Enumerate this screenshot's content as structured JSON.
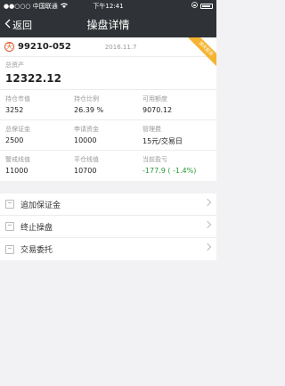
{
  "status_bar": {
    "carrier": "●●○○○ 中国联通",
    "wifi_icon": "wifi-icon",
    "time": "下午12:41",
    "lock_icon": "orientation-lock-icon",
    "battery_icon": "battery-icon"
  },
  "nav": {
    "back_label": "返回",
    "back_icon": "chevron-left-icon",
    "title": "操盘详情"
  },
  "account": {
    "icon_glyph": "天",
    "id": "99210-052",
    "date": "2016.11.7",
    "ribbon": "按天配资"
  },
  "total": {
    "label": "总资产",
    "value": "12322.12"
  },
  "rows": [
    [
      {
        "label": "持仓市值",
        "value": "3252"
      },
      {
        "label": "持仓比例",
        "value": "26.39 %"
      },
      {
        "label": "可用额度",
        "value": "9070.12"
      }
    ],
    [
      {
        "label": "总保证金",
        "value": "2500"
      },
      {
        "label": "申请资金",
        "value": "10000"
      },
      {
        "label": "管理费",
        "value": "15元/交易日"
      }
    ],
    [
      {
        "label": "警戒线值",
        "value": "11000"
      },
      {
        "label": "平仓线值",
        "value": "10700"
      },
      {
        "label": "当前盈亏",
        "value": "-177.9 ( -1.4%)"
      }
    ]
  ],
  "menu": {
    "items": [
      {
        "label": "追加保证金",
        "icon": "add-margin-icon"
      },
      {
        "label": "终止操盘",
        "icon": "stop-trading-icon"
      },
      {
        "label": "交易委托",
        "icon": "trade-order-icon"
      }
    ]
  },
  "colors": {
    "header_bg": "#2f3236",
    "profit_loss": "#2a9a3a",
    "ribbon": "#f4b431",
    "account_icon": "#e25a2a"
  }
}
